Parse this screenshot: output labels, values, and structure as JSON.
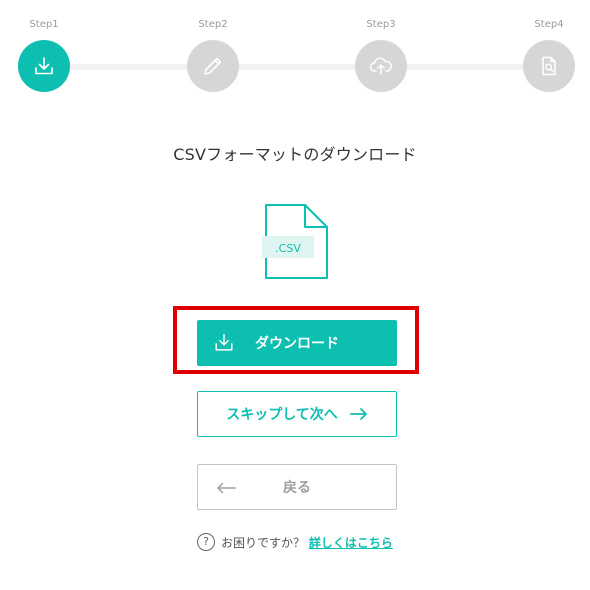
{
  "colors": {
    "accent": "#0dbfb0",
    "inactive_step": "#d6d6d6",
    "highlight": "#e00000"
  },
  "stepper": {
    "steps": [
      {
        "label": "Step1",
        "icon": "download-icon",
        "active": true
      },
      {
        "label": "Step2",
        "icon": "pencil-icon",
        "active": false
      },
      {
        "label": "Step3",
        "icon": "cloud-upload-icon",
        "active": false
      },
      {
        "label": "Step4",
        "icon": "document-search-icon",
        "active": false
      }
    ]
  },
  "main": {
    "title": "CSVフォーマットのダウンロード",
    "file_icon_label": ".CSV",
    "download_button": "ダウンロード",
    "skip_button": "スキップして次へ",
    "back_button": "戻る"
  },
  "help": {
    "question_mark": "?",
    "text": "お困りですか？",
    "link_text": "詳しくはこちら"
  }
}
